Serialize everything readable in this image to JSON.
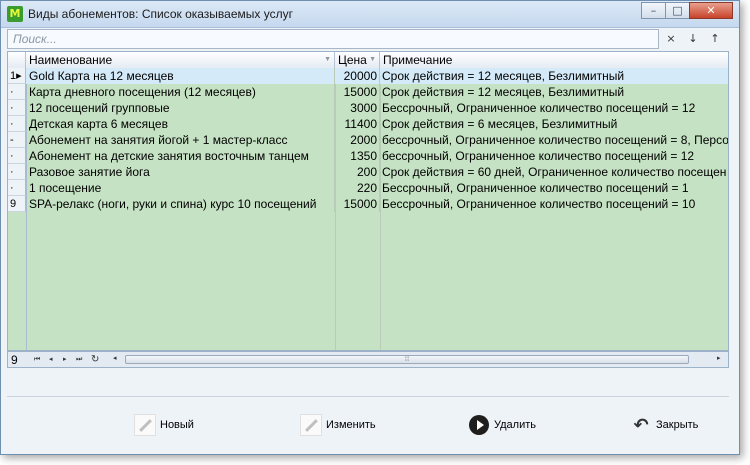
{
  "window": {
    "title": "Виды абонементов: Список оказываемых услуг",
    "app_icon": "app-logo-icon",
    "buttons": {
      "minimize": "–",
      "maximize": "□",
      "close": "✕"
    }
  },
  "search": {
    "placeholder": "Поиск...",
    "clear_icon": "×",
    "down_icon": "↓",
    "up_icon": "↑"
  },
  "table": {
    "columns": [
      "Наименование",
      "Цена",
      "Примечание"
    ],
    "rows": [
      {
        "ind": "1▸",
        "name": "Gold Карта на 12 месяцев",
        "price": "20000",
        "note": "Срок действия = 12 месяцев, Безлимитный"
      },
      {
        "ind": "·",
        "name": "Карта дневного посещения (12 месяцев)",
        "price": "15000",
        "note": "Срок действия = 12 месяцев, Безлимитный"
      },
      {
        "ind": "·",
        "name": "12 посещений групповые",
        "price": "3000",
        "note": "Бессрочный, Ограниченное количество посещений = 12"
      },
      {
        "ind": "·",
        "name": "Детская карта 6 месяцев",
        "price": "11400",
        "note": "Срок действия = 6 месяцев, Безлимитный"
      },
      {
        "ind": "-",
        "name": "Абонемент на занятия йогой + 1 мастер-класс",
        "price": "2000",
        "note": "бессрочный, Ограниченное количество посещений = 8, Персо"
      },
      {
        "ind": "·",
        "name": "Абонемент на детские занятия восточным танцем",
        "price": "1350",
        "note": "бессрочный, Ограниченное количество посещений = 12"
      },
      {
        "ind": "·",
        "name": "Разовое занятие йога",
        "price": "200",
        "note": "Срок действия = 60 дней, Ограниченное количество посещен"
      },
      {
        "ind": "·",
        "name": "1 посещение",
        "price": "220",
        "note": "Бессрочный, Ограниченное количество посещений = 1"
      },
      {
        "ind": "9",
        "name": "SPA-релакс (ноги, руки и спина) курс 10 посещений",
        "price": "15000",
        "note": "Бессрочный, Ограниченное количество посещений = 10"
      }
    ],
    "record_count": "9"
  },
  "navigator": {
    "first": "⏮",
    "prev": "◂",
    "next": "▸",
    "last": "⏭",
    "refresh": "↻",
    "scroll_left": "◂",
    "scroll_right": "▸",
    "thumb_grip": "⦙⦙⦙"
  },
  "actions": {
    "new_label": "Новый",
    "edit_label": "Изменить",
    "delete_label": "Удалить",
    "close_label": "Закрыть"
  }
}
